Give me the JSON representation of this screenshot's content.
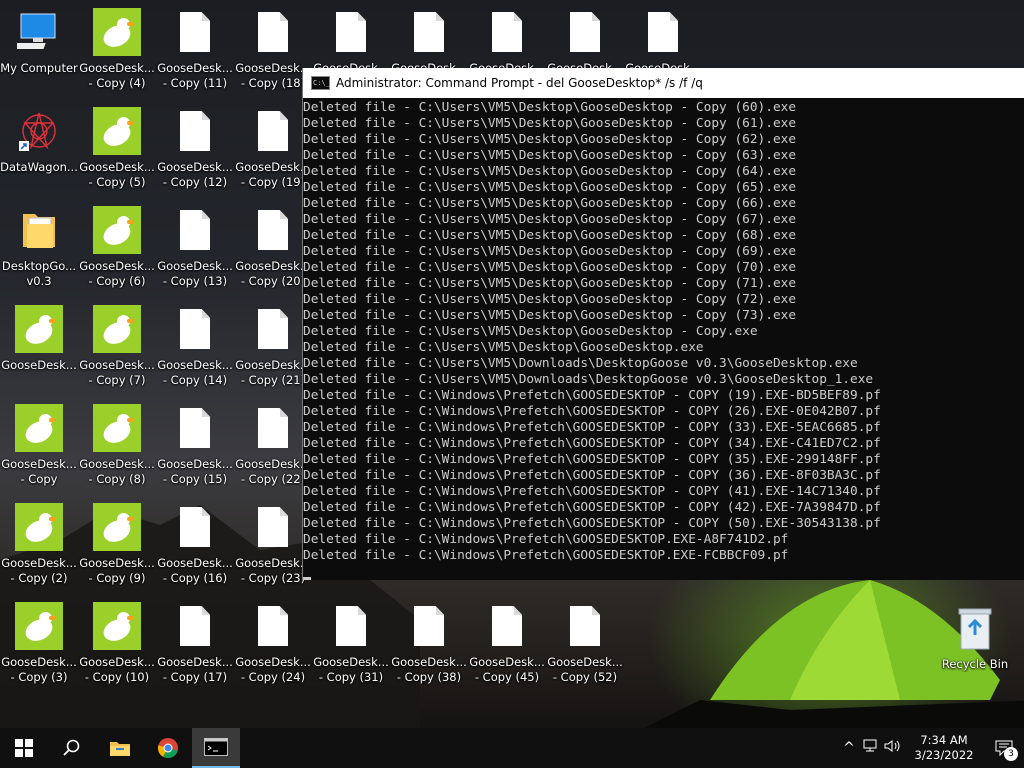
{
  "desktop": {
    "icons": [
      {
        "label": "My Computer",
        "type": "computer",
        "col": 0,
        "row": 0
      },
      {
        "label": "DataWagon...",
        "type": "datawagon",
        "col": 0,
        "row": 1
      },
      {
        "label": "DesktopGo...\nv0.3",
        "type": "folder",
        "col": 0,
        "row": 2
      },
      {
        "label": "GooseDesk...",
        "type": "goose",
        "col": 0,
        "row": 3
      },
      {
        "label": "GooseDesk...\n- Copy",
        "type": "goose",
        "col": 0,
        "row": 4
      },
      {
        "label": "GooseDesk...\n- Copy (2)",
        "type": "goose",
        "col": 0,
        "row": 5
      },
      {
        "label": "GooseDesk...\n- Copy (3)",
        "type": "goose",
        "col": 0,
        "row": 6
      },
      {
        "label": "GooseDesk...\n- Copy (4)",
        "type": "goose",
        "col": 1,
        "row": 0
      },
      {
        "label": "GooseDesk...\n- Copy (5)",
        "type": "goose",
        "col": 1,
        "row": 1
      },
      {
        "label": "GooseDesk...\n- Copy (6)",
        "type": "goose",
        "col": 1,
        "row": 2
      },
      {
        "label": "GooseDesk...\n- Copy (7)",
        "type": "goose",
        "col": 1,
        "row": 3
      },
      {
        "label": "GooseDesk...\n- Copy (8)",
        "type": "goose",
        "col": 1,
        "row": 4
      },
      {
        "label": "GooseDesk...\n- Copy (9)",
        "type": "goose",
        "col": 1,
        "row": 5
      },
      {
        "label": "GooseDesk...\n- Copy (10)",
        "type": "goose",
        "col": 1,
        "row": 6
      },
      {
        "label": "GooseDesk...\n- Copy (11)",
        "type": "file",
        "col": 2,
        "row": 0
      },
      {
        "label": "GooseDesk...\n- Copy (12)",
        "type": "file",
        "col": 2,
        "row": 1
      },
      {
        "label": "GooseDesk...\n- Copy (13)",
        "type": "file",
        "col": 2,
        "row": 2
      },
      {
        "label": "GooseDesk...\n- Copy (14)",
        "type": "file",
        "col": 2,
        "row": 3
      },
      {
        "label": "GooseDesk...\n- Copy (15)",
        "type": "file",
        "col": 2,
        "row": 4
      },
      {
        "label": "GooseDesk...\n- Copy (16)",
        "type": "file",
        "col": 2,
        "row": 5
      },
      {
        "label": "GooseDesk...\n- Copy (17)",
        "type": "file",
        "col": 2,
        "row": 6
      },
      {
        "label": "GooseDesk...\n- Copy (18)",
        "type": "file",
        "col": 3,
        "row": 0
      },
      {
        "label": "GooseDesk...\n- Copy (19)",
        "type": "file",
        "col": 3,
        "row": 1
      },
      {
        "label": "GooseDesk...\n- Copy (20)",
        "type": "file",
        "col": 3,
        "row": 2
      },
      {
        "label": "GooseDesk...\n- Copy (21)",
        "type": "file",
        "col": 3,
        "row": 3
      },
      {
        "label": "GooseDesk...\n- Copy (22)",
        "type": "file",
        "col": 3,
        "row": 4
      },
      {
        "label": "GooseDesk...\n- Copy (23)",
        "type": "file",
        "col": 3,
        "row": 5
      },
      {
        "label": "GooseDesk...\n- Copy (24)",
        "type": "file",
        "col": 3,
        "row": 6
      },
      {
        "label": "GooseDesk...",
        "type": "file",
        "col": 4,
        "row": 0
      },
      {
        "label": "GooseDesk...\n- Copy (31)",
        "type": "file",
        "col": 4,
        "row": 6
      },
      {
        "label": "GooseDesk...",
        "type": "file",
        "col": 5,
        "row": 0
      },
      {
        "label": "GooseDesk...\n- Copy (38)",
        "type": "file",
        "col": 5,
        "row": 6
      },
      {
        "label": "GooseDesk...",
        "type": "file",
        "col": 6,
        "row": 0
      },
      {
        "label": "GooseDesk...\n- Copy (45)",
        "type": "file",
        "col": 6,
        "row": 6
      },
      {
        "label": "GooseDesk...",
        "type": "file",
        "col": 7,
        "row": 0
      },
      {
        "label": "GooseDesk...\n- Copy (52)",
        "type": "file",
        "col": 7,
        "row": 6
      },
      {
        "label": "GooseDesk...",
        "type": "file",
        "col": 8,
        "row": 0
      }
    ],
    "recycle_bin_label": "Recycle Bin"
  },
  "cmd": {
    "title": "Administrator: Command Prompt - del  GooseDesktop* /s /f /q",
    "icon_text": "C:\\_",
    "lines": [
      "Deleted file - C:\\Users\\VM5\\Desktop\\GooseDesktop - Copy (60).exe",
      "Deleted file - C:\\Users\\VM5\\Desktop\\GooseDesktop - Copy (61).exe",
      "Deleted file - C:\\Users\\VM5\\Desktop\\GooseDesktop - Copy (62).exe",
      "Deleted file - C:\\Users\\VM5\\Desktop\\GooseDesktop - Copy (63).exe",
      "Deleted file - C:\\Users\\VM5\\Desktop\\GooseDesktop - Copy (64).exe",
      "Deleted file - C:\\Users\\VM5\\Desktop\\GooseDesktop - Copy (65).exe",
      "Deleted file - C:\\Users\\VM5\\Desktop\\GooseDesktop - Copy (66).exe",
      "Deleted file - C:\\Users\\VM5\\Desktop\\GooseDesktop - Copy (67).exe",
      "Deleted file - C:\\Users\\VM5\\Desktop\\GooseDesktop - Copy (68).exe",
      "Deleted file - C:\\Users\\VM5\\Desktop\\GooseDesktop - Copy (69).exe",
      "Deleted file - C:\\Users\\VM5\\Desktop\\GooseDesktop - Copy (70).exe",
      "Deleted file - C:\\Users\\VM5\\Desktop\\GooseDesktop - Copy (71).exe",
      "Deleted file - C:\\Users\\VM5\\Desktop\\GooseDesktop - Copy (72).exe",
      "Deleted file - C:\\Users\\VM5\\Desktop\\GooseDesktop - Copy (73).exe",
      "Deleted file - C:\\Users\\VM5\\Desktop\\GooseDesktop - Copy.exe",
      "Deleted file - C:\\Users\\VM5\\Desktop\\GooseDesktop.exe",
      "Deleted file - C:\\Users\\VM5\\Downloads\\DesktopGoose v0.3\\GooseDesktop.exe",
      "Deleted file - C:\\Users\\VM5\\Downloads\\DesktopGoose v0.3\\GooseDesktop_1.exe",
      "Deleted file - C:\\Windows\\Prefetch\\GOOSEDESKTOP - COPY (19).EXE-BD5BEF89.pf",
      "Deleted file - C:\\Windows\\Prefetch\\GOOSEDESKTOP - COPY (26).EXE-0E042B07.pf",
      "Deleted file - C:\\Windows\\Prefetch\\GOOSEDESKTOP - COPY (33).EXE-5EAC6685.pf",
      "Deleted file - C:\\Windows\\Prefetch\\GOOSEDESKTOP - COPY (34).EXE-C41ED7C2.pf",
      "Deleted file - C:\\Windows\\Prefetch\\GOOSEDESKTOP - COPY (35).EXE-299148FF.pf",
      "Deleted file - C:\\Windows\\Prefetch\\GOOSEDESKTOP - COPY (36).EXE-8F03BA3C.pf",
      "Deleted file - C:\\Windows\\Prefetch\\GOOSEDESKTOP - COPY (41).EXE-14C71340.pf",
      "Deleted file - C:\\Windows\\Prefetch\\GOOSEDESKTOP - COPY (42).EXE-7A39847D.pf",
      "Deleted file - C:\\Windows\\Prefetch\\GOOSEDESKTOP - COPY (50).EXE-30543138.pf",
      "Deleted file - C:\\Windows\\Prefetch\\GOOSEDESKTOP.EXE-A8F741D2.pf",
      "Deleted file - C:\\Windows\\Prefetch\\GOOSEDESKTOP.EXE-FCBBCF09.pf"
    ]
  },
  "taskbar": {
    "start_icon": "windows-logo-icon",
    "apps": [
      "search-icon",
      "file-explorer-icon",
      "chrome-icon",
      "command-prompt-icon"
    ],
    "time": "7:34 AM",
    "date": "3/23/2022",
    "notification_count": "3",
    "chevron": "^"
  },
  "colors": {
    "goose_green": "#9bd02a",
    "console_bg": "#0c0c0c",
    "console_text": "#cccccc",
    "taskbar_bg": "#101010",
    "active_underline": "#76b9ed"
  }
}
